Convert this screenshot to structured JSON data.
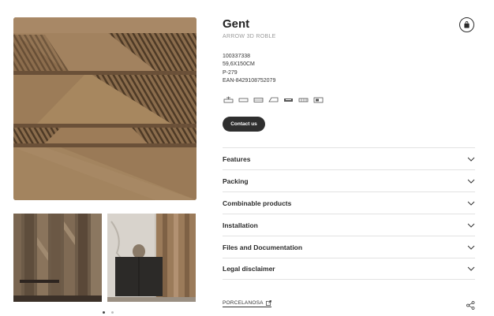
{
  "product": {
    "name": "Gent",
    "subtitle": "ARROW 3D ROBLE",
    "specs": [
      "100337338",
      "59,6X150CM",
      "P-279",
      "EAN-8429108752079"
    ]
  },
  "actions": {
    "contact_label": "Contact us"
  },
  "accordion": [
    {
      "label": "Features"
    },
    {
      "label": "Packing"
    },
    {
      "label": "Combinable products"
    },
    {
      "label": "Installation"
    },
    {
      "label": "Files and Documentation"
    },
    {
      "label": "Legal disclaimer"
    }
  ],
  "footer": {
    "brand_link": "PORCELANOSA"
  },
  "icons": [
    "bag-icon",
    "usage-icon-1",
    "usage-icon-2",
    "usage-icon-3",
    "usage-icon-4",
    "usage-icon-5",
    "usage-icon-6",
    "usage-icon-7",
    "external-link-icon",
    "share-icon",
    "chevron-down-icon"
  ],
  "gallery": {
    "current_slide": 1,
    "total_slides": 2
  },
  "colors": {
    "button": "#2f2f2f",
    "wood_light": "#9c7e5c",
    "wood_dark": "#5c4630"
  }
}
